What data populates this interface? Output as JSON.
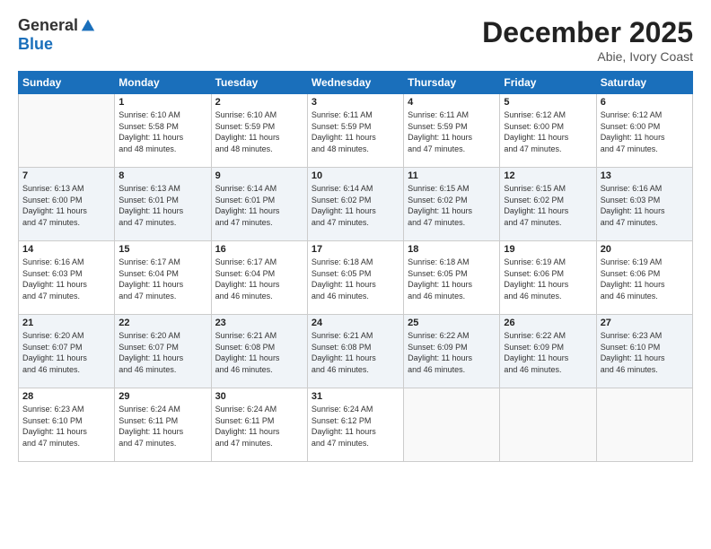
{
  "logo": {
    "general": "General",
    "blue": "Blue"
  },
  "title": "December 2025",
  "subtitle": "Abie, Ivory Coast",
  "days": [
    "Sunday",
    "Monday",
    "Tuesday",
    "Wednesday",
    "Thursday",
    "Friday",
    "Saturday"
  ],
  "weeks": [
    [
      {
        "day": "",
        "info": ""
      },
      {
        "day": "1",
        "info": "Sunrise: 6:10 AM\nSunset: 5:58 PM\nDaylight: 11 hours\nand 48 minutes."
      },
      {
        "day": "2",
        "info": "Sunrise: 6:10 AM\nSunset: 5:59 PM\nDaylight: 11 hours\nand 48 minutes."
      },
      {
        "day": "3",
        "info": "Sunrise: 6:11 AM\nSunset: 5:59 PM\nDaylight: 11 hours\nand 48 minutes."
      },
      {
        "day": "4",
        "info": "Sunrise: 6:11 AM\nSunset: 5:59 PM\nDaylight: 11 hours\nand 47 minutes."
      },
      {
        "day": "5",
        "info": "Sunrise: 6:12 AM\nSunset: 6:00 PM\nDaylight: 11 hours\nand 47 minutes."
      },
      {
        "day": "6",
        "info": "Sunrise: 6:12 AM\nSunset: 6:00 PM\nDaylight: 11 hours\nand 47 minutes."
      }
    ],
    [
      {
        "day": "7",
        "info": "Sunrise: 6:13 AM\nSunset: 6:00 PM\nDaylight: 11 hours\nand 47 minutes."
      },
      {
        "day": "8",
        "info": "Sunrise: 6:13 AM\nSunset: 6:01 PM\nDaylight: 11 hours\nand 47 minutes."
      },
      {
        "day": "9",
        "info": "Sunrise: 6:14 AM\nSunset: 6:01 PM\nDaylight: 11 hours\nand 47 minutes."
      },
      {
        "day": "10",
        "info": "Sunrise: 6:14 AM\nSunset: 6:02 PM\nDaylight: 11 hours\nand 47 minutes."
      },
      {
        "day": "11",
        "info": "Sunrise: 6:15 AM\nSunset: 6:02 PM\nDaylight: 11 hours\nand 47 minutes."
      },
      {
        "day": "12",
        "info": "Sunrise: 6:15 AM\nSunset: 6:02 PM\nDaylight: 11 hours\nand 47 minutes."
      },
      {
        "day": "13",
        "info": "Sunrise: 6:16 AM\nSunset: 6:03 PM\nDaylight: 11 hours\nand 47 minutes."
      }
    ],
    [
      {
        "day": "14",
        "info": "Sunrise: 6:16 AM\nSunset: 6:03 PM\nDaylight: 11 hours\nand 47 minutes."
      },
      {
        "day": "15",
        "info": "Sunrise: 6:17 AM\nSunset: 6:04 PM\nDaylight: 11 hours\nand 47 minutes."
      },
      {
        "day": "16",
        "info": "Sunrise: 6:17 AM\nSunset: 6:04 PM\nDaylight: 11 hours\nand 46 minutes."
      },
      {
        "day": "17",
        "info": "Sunrise: 6:18 AM\nSunset: 6:05 PM\nDaylight: 11 hours\nand 46 minutes."
      },
      {
        "day": "18",
        "info": "Sunrise: 6:18 AM\nSunset: 6:05 PM\nDaylight: 11 hours\nand 46 minutes."
      },
      {
        "day": "19",
        "info": "Sunrise: 6:19 AM\nSunset: 6:06 PM\nDaylight: 11 hours\nand 46 minutes."
      },
      {
        "day": "20",
        "info": "Sunrise: 6:19 AM\nSunset: 6:06 PM\nDaylight: 11 hours\nand 46 minutes."
      }
    ],
    [
      {
        "day": "21",
        "info": "Sunrise: 6:20 AM\nSunset: 6:07 PM\nDaylight: 11 hours\nand 46 minutes."
      },
      {
        "day": "22",
        "info": "Sunrise: 6:20 AM\nSunset: 6:07 PM\nDaylight: 11 hours\nand 46 minutes."
      },
      {
        "day": "23",
        "info": "Sunrise: 6:21 AM\nSunset: 6:08 PM\nDaylight: 11 hours\nand 46 minutes."
      },
      {
        "day": "24",
        "info": "Sunrise: 6:21 AM\nSunset: 6:08 PM\nDaylight: 11 hours\nand 46 minutes."
      },
      {
        "day": "25",
        "info": "Sunrise: 6:22 AM\nSunset: 6:09 PM\nDaylight: 11 hours\nand 46 minutes."
      },
      {
        "day": "26",
        "info": "Sunrise: 6:22 AM\nSunset: 6:09 PM\nDaylight: 11 hours\nand 46 minutes."
      },
      {
        "day": "27",
        "info": "Sunrise: 6:23 AM\nSunset: 6:10 PM\nDaylight: 11 hours\nand 46 minutes."
      }
    ],
    [
      {
        "day": "28",
        "info": "Sunrise: 6:23 AM\nSunset: 6:10 PM\nDaylight: 11 hours\nand 47 minutes."
      },
      {
        "day": "29",
        "info": "Sunrise: 6:24 AM\nSunset: 6:11 PM\nDaylight: 11 hours\nand 47 minutes."
      },
      {
        "day": "30",
        "info": "Sunrise: 6:24 AM\nSunset: 6:11 PM\nDaylight: 11 hours\nand 47 minutes."
      },
      {
        "day": "31",
        "info": "Sunrise: 6:24 AM\nSunset: 6:12 PM\nDaylight: 11 hours\nand 47 minutes."
      },
      {
        "day": "",
        "info": ""
      },
      {
        "day": "",
        "info": ""
      },
      {
        "day": "",
        "info": ""
      }
    ]
  ]
}
